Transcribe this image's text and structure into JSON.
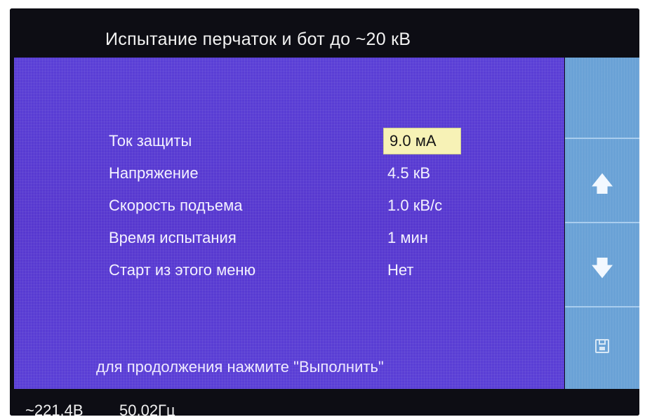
{
  "header": {
    "title": "Испытание перчаток и бот до ~20 кВ"
  },
  "params": [
    {
      "label": "Ток защиты",
      "value": "9.0 мА",
      "selected": true
    },
    {
      "label": "Напряжение",
      "value": "4.5 кВ"
    },
    {
      "label": "Скорость подъема",
      "value": "1.0 кВ/с"
    },
    {
      "label": "Время испытания",
      "value": "1 мин"
    },
    {
      "label": "Старт из этого меню",
      "value": "Нет"
    }
  ],
  "hint": "для продолжения нажмите \"Выполнить\"",
  "side_buttons": [
    {
      "name": "blank",
      "icon": ""
    },
    {
      "name": "up",
      "icon": "arrow-up-icon"
    },
    {
      "name": "down",
      "icon": "arrow-down-icon"
    },
    {
      "name": "save",
      "icon": "save-icon"
    }
  ],
  "status": {
    "voltage": "~221.4В",
    "frequency": "50.02Гц"
  },
  "colors": {
    "main_panel": "#5738cf",
    "side_panel": "#6aa2d6",
    "selected_field": "#f7f2b6",
    "background": "#0d0d14"
  }
}
